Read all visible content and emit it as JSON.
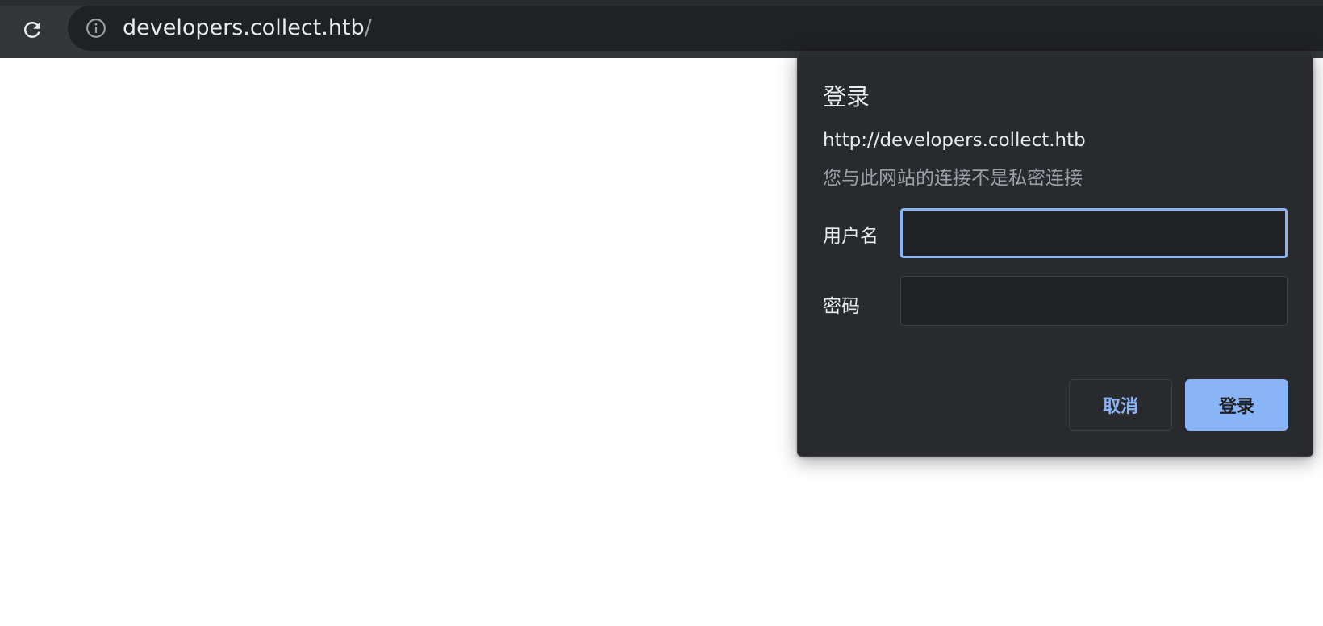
{
  "browser": {
    "url_host": "developers.collect.htb",
    "url_path": "/",
    "icons": {
      "reload": "reload-icon",
      "site_info": "info-icon"
    }
  },
  "auth_dialog": {
    "title": "登录",
    "origin": "http://developers.collect.htb",
    "warning": "您与此网站的连接不是私密连接",
    "username_label": "用户名",
    "username_value": "",
    "password_label": "密码",
    "password_value": "",
    "cancel_label": "取消",
    "login_label": "登录"
  },
  "colors": {
    "toolbar": "#35363a",
    "omnibox": "#202124",
    "dialog": "#292a2d",
    "accent": "#8ab4f8"
  }
}
